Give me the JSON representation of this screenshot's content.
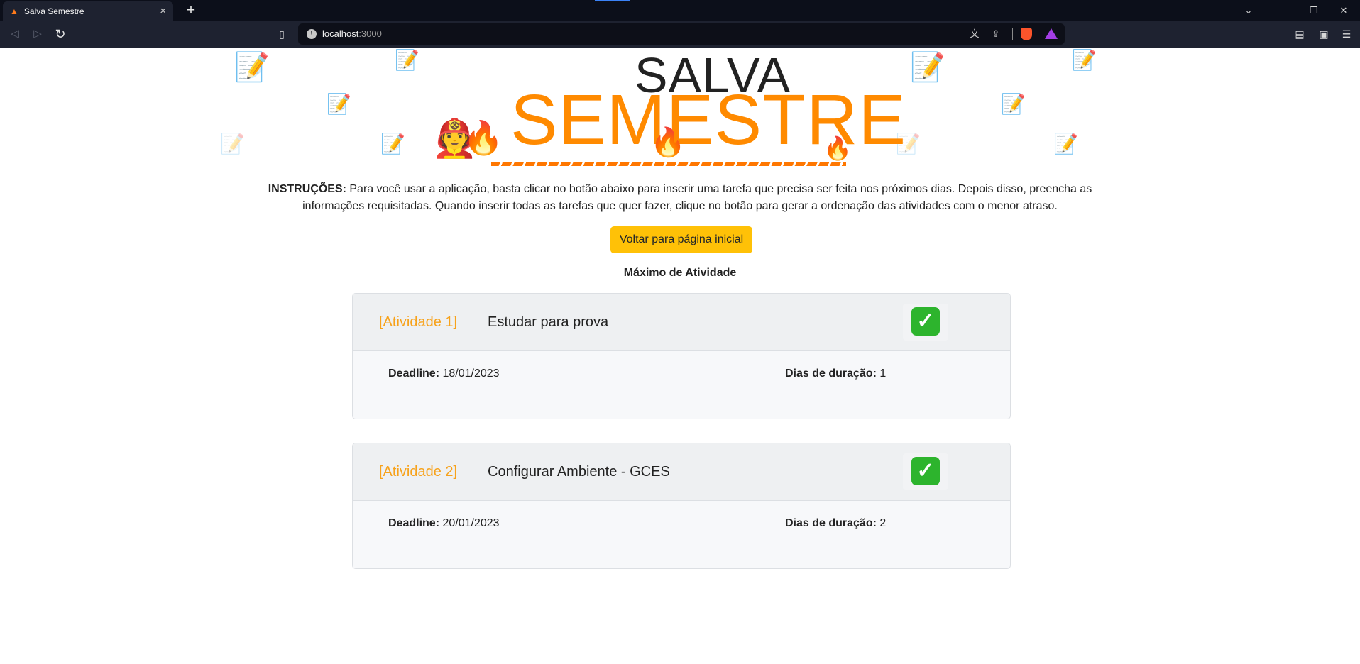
{
  "browser": {
    "tab_title": "Salva Semestre",
    "url_host": "localhost",
    "url_port": ":3000"
  },
  "hero": {
    "logo_line1": "SALVA",
    "logo_line2": "SEMESTRE"
  },
  "instructions": {
    "label": "INSTRUÇÕES:",
    "text": " Para você usar a aplicação, basta clicar no botão abaixo para inserir uma tarefa que precisa ser feita nos próximos dias. Depois disso, preencha as informações requisitadas. Quando inserir todas as tarefas que quer fazer, clique no botão para gerar a ordenação das atividades com o menor atraso."
  },
  "back_button": {
    "label": "Voltar para página inicial"
  },
  "section_title": "Máximo de Atividade",
  "activities": [
    {
      "index_label": "[Atividade 1]",
      "name": "Estudar para prova",
      "deadline_label": "Deadline:",
      "deadline": " 18/01/2023",
      "duration_label": "Dias de duração:",
      "duration": " 1"
    },
    {
      "index_label": "[Atividade 2]",
      "name": "Configurar Ambiente - GCES",
      "deadline_label": "Deadline:",
      "deadline": " 20/01/2023",
      "duration_label": "Dias de duração:",
      "duration": " 2"
    }
  ],
  "icons": {
    "check": "✓",
    "doc": "📝",
    "fire": "🔥",
    "firefighter": "🧑‍🚒"
  }
}
